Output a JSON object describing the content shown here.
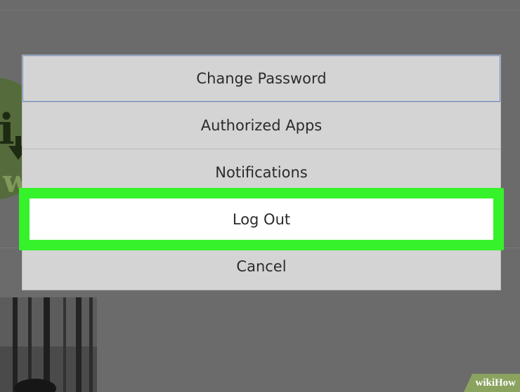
{
  "menu": {
    "items": [
      {
        "label": "Change Password"
      },
      {
        "label": "Authorized Apps"
      },
      {
        "label": "Notifications"
      },
      {
        "label": "Log Out"
      },
      {
        "label": "Cancel"
      }
    ]
  },
  "highlight": {
    "color": "#35f22a"
  },
  "watermark": {
    "text": "wikiHow"
  },
  "colors": {
    "overlay": "#6b6b6b",
    "menu_bg": "#d4d4d4",
    "selected_bg": "#ffffff"
  }
}
